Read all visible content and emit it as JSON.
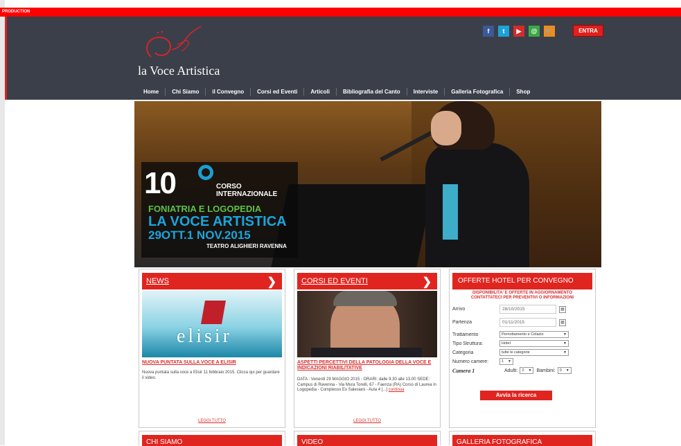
{
  "production_label": "PRODUCTION",
  "logo": {
    "text": "la Voce Artistica"
  },
  "social": [
    {
      "icon": "facebook-icon",
      "glyph": "f",
      "color": "#3b5998"
    },
    {
      "icon": "twitter-icon",
      "glyph": "t",
      "color": "#1da1d8"
    },
    {
      "icon": "youtube-icon",
      "glyph": "▶",
      "color": "#d52b2b"
    },
    {
      "icon": "email-icon",
      "glyph": "@",
      "color": "#3aa845"
    },
    {
      "icon": "cart-icon",
      "glyph": "🛒",
      "color": "#f08c1d"
    }
  ],
  "entra_label": "ENTRA",
  "nav": [
    "Home",
    "Chi Siamo",
    "il Convegno",
    "Corsi ed Eventi",
    "Articoli",
    "Bibliografia del Canto",
    "Interviste",
    "Galleria Fotografica",
    "Shop"
  ],
  "hero": {
    "number": "10",
    "corso_line1": "CORSO",
    "corso_line2": "INTERNAZIONALE",
    "foniatria": "FONIATRIA E LOGOPEDIA",
    "voce": "LA VOCE ARTISTICA",
    "date": "29OTT.1 NOV.2015",
    "teatro": "TEATRO ALIGHIERI RAVENNA"
  },
  "news": {
    "header": "NEWS",
    "title": "NUOVA PUNTATA SULLA VOCE A ELISIR",
    "text": "Nuova puntata sulla voce a Elisir 11 febbraio 2015. Clicca qui per guardare il video.",
    "more": "LEGGI TUTTO",
    "image_text": "elisir"
  },
  "corsi": {
    "header": "CORSI ED EVENTI",
    "title": "ASPETTI PERCETTIVI DELLA PATOLOGIA DELLA VOCE E INDICAZIONI RIABILITATIVE",
    "text": "DATA : Venerdì 29 MAGGIO 2015 - ORARI: dalle 9.30 alle 13.00 SEDE: Campus di Ravenna - Via Mura Torelli, 67 - Faenza (RA) Corso di Laurea in Logopedia - Complesso Ex Salesiani - Aula 4",
    "ellipsis": "[...]",
    "continua": "continua",
    "more": "LEGGI TUTTO"
  },
  "hotel": {
    "header": "OFFERTE HOTEL PER CONVEGNO",
    "note_line1": "DISPONIBILITA' E OFFERTE IN AGGIORNAMENTO",
    "note_line2": "CONTATTATECI PER PREVENTIVI O INFORMAZIONI",
    "arrivo_label": "Arrivo",
    "arrivo_value": "28/10/2015",
    "partenza_label": "Partenza",
    "partenza_value": "01/11/2015",
    "trattamento_label": "Trattamento",
    "trattamento_value": "Pernottamento e Colazio",
    "tipo_label": "Tipo Struttura:",
    "tipo_value": "Hotel",
    "categoria_label": "Categoria",
    "categoria_value": "tutte le categorie",
    "camere_label": "Numero camere:",
    "camere_value": "1",
    "camera_label": "Camera 1",
    "adulti_label": "Adulti:",
    "adulti_value": "2",
    "bambini_label": "Bambini:",
    "bambini_value": "0",
    "search_label": "Avvia la ricerca"
  },
  "bottom": [
    "CHI SIAMO",
    "VIDEO",
    "GALLERIA FOTOGRAFICA"
  ]
}
